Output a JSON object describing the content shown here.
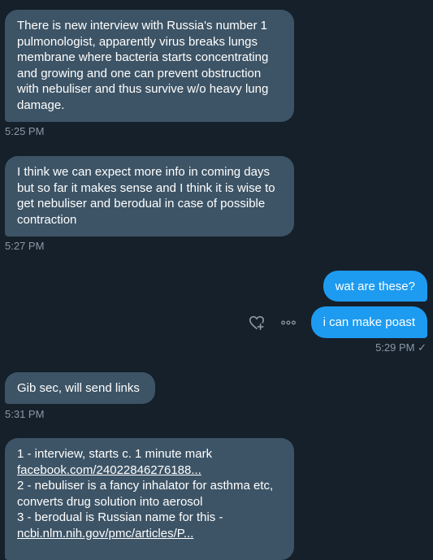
{
  "messages": [
    {
      "text": "There is new interview with Russia's number 1 pulmonologist, apparently virus breaks lungs membrane where bacteria starts concentrating and growing and one can prevent obstruction with nebuliser and thus survive w/o heavy lung damage.",
      "time": "5:25 PM"
    },
    {
      "text": "I think we can expect more info in coming days but so far it makes sense and I think it is wise to get nebuliser and berodual in case of possible contraction",
      "time": "5:27 PM"
    },
    {
      "out1": "wat are these?",
      "out2": "i can make poast",
      "time": "5:29 PM ✓"
    },
    {
      "text": "Gib sec, will send links",
      "time": "5:31 PM"
    },
    {
      "line1": "1 - interview, starts c. 1 minute mark",
      "link1": "facebook.com/24022846276188...",
      "line2": "2 - nebuliser is a fancy inhalator for asthma etc, converts drug solution into aerosol",
      "line3": "3 - berodual is Russian name for this -",
      "link2": "ncbi.nlm.nih.gov/pmc/articles/P..."
    }
  ],
  "icons": {
    "react": "heart-plus-icon",
    "more": "more-horizontal-icon"
  }
}
